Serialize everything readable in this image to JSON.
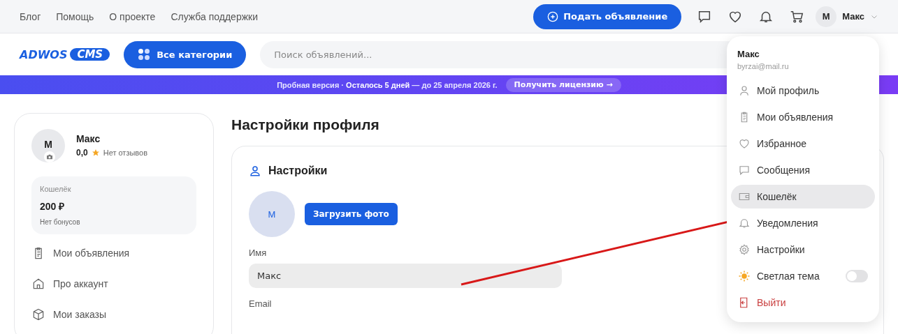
{
  "top_links": [
    "Блог",
    "Помощь",
    "О проекте",
    "Служба поддержки"
  ],
  "post_button": "Подать объявление",
  "user": {
    "initial": "M",
    "name": "Макс"
  },
  "logo": {
    "word": "ADWOS",
    "badge": "CMS"
  },
  "categories_button": "Все категории",
  "search": {
    "placeholder": "Поиск объявлений..."
  },
  "trial_banner": {
    "text": "Пробная версия · **Осталось 5 дней** — до 25 апреля 2026 г.",
    "button": "Получить лицензию →"
  },
  "sidebar": {
    "initial": "M",
    "name": "Макс",
    "rating": "0,0",
    "reviews": "Нет отзывов",
    "wallet": {
      "label": "Кошелёк",
      "amount": "200 ₽",
      "bonus": "Нет бонусов"
    },
    "items": [
      "Мои объявления",
      "Про аккаунт",
      "Мои заказы"
    ]
  },
  "page_title": "Настройки профиля",
  "settings_card": {
    "title": "Настройки",
    "avatar_initial": "M",
    "upload_button": "Загрузить фото",
    "fields": [
      {
        "label": "Имя",
        "value": "Макс"
      },
      {
        "label": "Email"
      }
    ]
  },
  "user_menu": {
    "name": "Макс",
    "email": "byrzai@mail.ru",
    "items": [
      {
        "kind": "link",
        "label": "Мой профиль",
        "selected": false
      },
      {
        "kind": "link",
        "label": "Мои объявления",
        "selected": false
      },
      {
        "kind": "link",
        "label": "Избранное",
        "selected": false
      },
      {
        "kind": "link",
        "label": "Сообщения",
        "selected": false
      },
      {
        "kind": "link",
        "label": "Кошелёк",
        "selected": true
      },
      {
        "kind": "link",
        "label": "Уведомления",
        "selected": false
      },
      {
        "kind": "link",
        "label": "Настройки",
        "selected": false
      },
      {
        "kind": "toggle",
        "label": "Светлая тема",
        "on": false,
        "selected": false
      },
      {
        "kind": "logout",
        "label": "Выйти",
        "selected": false
      }
    ]
  }
}
